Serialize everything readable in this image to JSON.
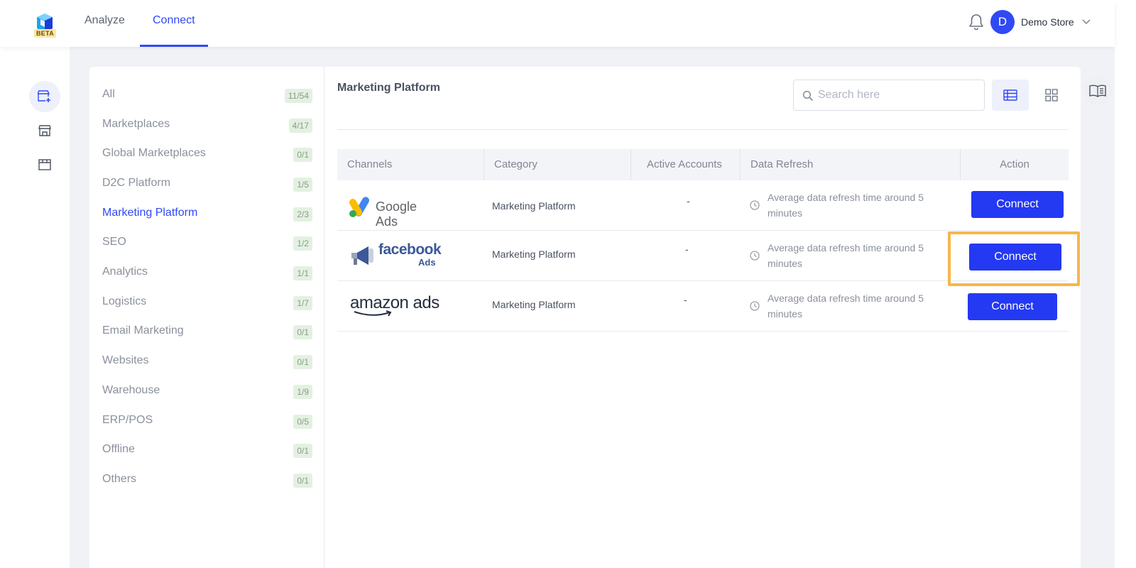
{
  "brand": {
    "badge": "BETA",
    "accent": "#2f49f5"
  },
  "nav": {
    "tabs": [
      {
        "label": "Analyze"
      },
      {
        "label": "Connect"
      }
    ],
    "active": "Connect"
  },
  "user": {
    "initial": "D",
    "store": "Demo Store"
  },
  "rail": {
    "items": [
      "add-store-icon",
      "store-icon",
      "warehouse-icon"
    ]
  },
  "categories": [
    {
      "label": "All",
      "count": "11/54"
    },
    {
      "label": "Marketplaces",
      "count": "4/17"
    },
    {
      "label": "Global Marketplaces",
      "count": "0/1"
    },
    {
      "label": "D2C Platform",
      "count": "1/5"
    },
    {
      "label": "Marketing Platform",
      "count": "2/3"
    },
    {
      "label": "SEO",
      "count": "1/2"
    },
    {
      "label": "Analytics",
      "count": "1/1"
    },
    {
      "label": "Logistics",
      "count": "1/7"
    },
    {
      "label": "Email Marketing",
      "count": "0/1"
    },
    {
      "label": "Websites",
      "count": "0/1"
    },
    {
      "label": "Warehouse",
      "count": "1/9"
    },
    {
      "label": "ERP/POS",
      "count": "0/5"
    },
    {
      "label": "Offline",
      "count": "0/1"
    },
    {
      "label": "Others",
      "count": "0/1"
    }
  ],
  "main": {
    "title": "Marketing Platform",
    "search": {
      "placeholder": "Search here",
      "value": ""
    },
    "table": {
      "headers": {
        "channels": "Channels",
        "category": "Category",
        "accounts": "Active Accounts",
        "refresh": "Data Refresh",
        "action": "Action"
      },
      "rows": [
        {
          "channel": "Google Ads",
          "category": "Marketing Platform",
          "accounts": "-",
          "refresh": "Average data refresh time around 5 minutes",
          "action": "Connect"
        },
        {
          "channel": "facebook Ads",
          "category": "Marketing Platform",
          "accounts": "-",
          "refresh": "Average data refresh time around 5 minutes",
          "action": "Connect"
        },
        {
          "channel": "amazon ads",
          "category": "Marketing Platform",
          "accounts": "-",
          "refresh": "Average data refresh time around 5 minutes",
          "action": "Connect"
        }
      ]
    }
  },
  "logos": {
    "google": "Google Ads",
    "facebook": "facebook",
    "facebook_sub": "Ads",
    "amazon": "amazon ads"
  }
}
